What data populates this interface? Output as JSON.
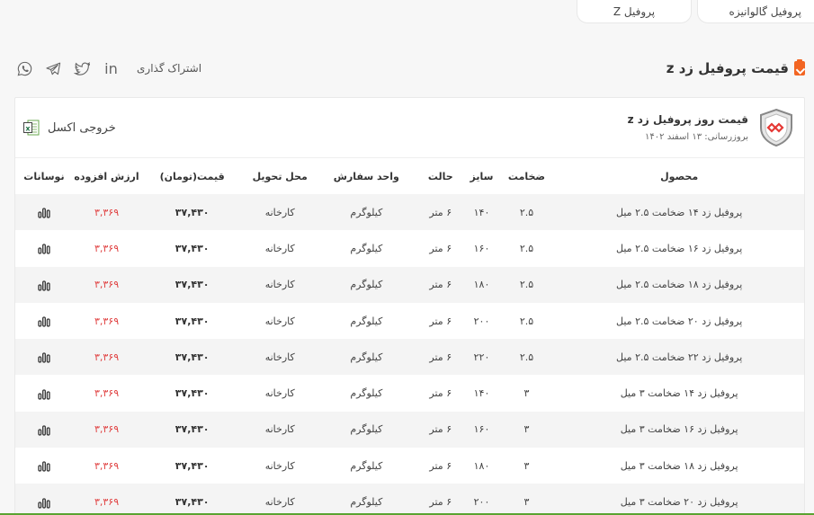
{
  "tabs": [
    {
      "label": "پروفیل گالوانیزه"
    },
    {
      "label": "پروفیل Z"
    }
  ],
  "page": {
    "title": "قیمت پروفیل زد z",
    "share_label": "اشتراک گذاری"
  },
  "social": [
    "linkedin-icon",
    "twitter-icon",
    "telegram-icon",
    "whatsapp-icon"
  ],
  "card": {
    "title": "قیمت روز پروفیل زد z",
    "updated": "بروزرسانی: ۱۳ اسفند ۱۴۰۲",
    "excel_label": "خروجی اکسل"
  },
  "columns": {
    "product": "محصول",
    "thickness": "ضخامت",
    "size": "سایز",
    "state": "حالت",
    "unit": "واحد سفارش",
    "delivery": "محل تحویل",
    "price": "قیمت(تومان)",
    "vat": "ارزش افزوده",
    "fluctuation": "نوسانات"
  },
  "rows": [
    {
      "product": "پروفیل زد ۱۴ ضخامت ۲.۵ میل",
      "thickness": "۲.۵",
      "size": "۱۴۰",
      "state": "۶ متر",
      "unit": "کیلوگرم",
      "delivery": "کارخانه",
      "price": "۳۷,۴۳۰",
      "vat": "۳,۳۶۹"
    },
    {
      "product": "پروفیل زد ۱۶ ضخامت ۲.۵ میل",
      "thickness": "۲.۵",
      "size": "۱۶۰",
      "state": "۶ متر",
      "unit": "کیلوگرم",
      "delivery": "کارخانه",
      "price": "۳۷,۴۳۰",
      "vat": "۳,۳۶۹"
    },
    {
      "product": "پروفیل زد ۱۸ ضخامت ۲.۵ میل",
      "thickness": "۲.۵",
      "size": "۱۸۰",
      "state": "۶ متر",
      "unit": "کیلوگرم",
      "delivery": "کارخانه",
      "price": "۳۷,۴۳۰",
      "vat": "۳,۳۶۹"
    },
    {
      "product": "پروفیل زد ۲۰ ضخامت ۲.۵ میل",
      "thickness": "۲.۵",
      "size": "۲۰۰",
      "state": "۶ متر",
      "unit": "کیلوگرم",
      "delivery": "کارخانه",
      "price": "۳۷,۴۳۰",
      "vat": "۳,۳۶۹"
    },
    {
      "product": "پروفیل زد ۲۲ ضخامت ۲.۵ میل",
      "thickness": "۲.۵",
      "size": "۲۲۰",
      "state": "۶ متر",
      "unit": "کیلوگرم",
      "delivery": "کارخانه",
      "price": "۳۷,۴۳۰",
      "vat": "۳,۳۶۹"
    },
    {
      "product": "پروفیل زد ۱۴ ضخامت ۳ میل",
      "thickness": "۳",
      "size": "۱۴۰",
      "state": "۶ متر",
      "unit": "کیلوگرم",
      "delivery": "کارخانه",
      "price": "۳۷,۴۳۰",
      "vat": "۳,۳۶۹"
    },
    {
      "product": "پروفیل زد ۱۶ ضخامت ۳ میل",
      "thickness": "۳",
      "size": "۱۶۰",
      "state": "۶ متر",
      "unit": "کیلوگرم",
      "delivery": "کارخانه",
      "price": "۳۷,۴۳۰",
      "vat": "۳,۳۶۹"
    },
    {
      "product": "پروفیل زد ۱۸ ضخامت ۳ میل",
      "thickness": "۳",
      "size": "۱۸۰",
      "state": "۶ متر",
      "unit": "کیلوگرم",
      "delivery": "کارخانه",
      "price": "۳۷,۴۳۰",
      "vat": "۳,۳۶۹"
    },
    {
      "product": "پروفیل زد ۲۰ ضخامت ۳ میل",
      "thickness": "۳",
      "size": "۲۰۰",
      "state": "۶ متر",
      "unit": "کیلوگرم",
      "delivery": "کارخانه",
      "price": "۳۷,۴۳۰",
      "vat": "۳,۳۶۹"
    }
  ],
  "colors": {
    "accent_orange": "#f26522",
    "vat_red": "#e04141",
    "bottom_bar_green": "#5aa331",
    "logo_red": "#e53935"
  }
}
